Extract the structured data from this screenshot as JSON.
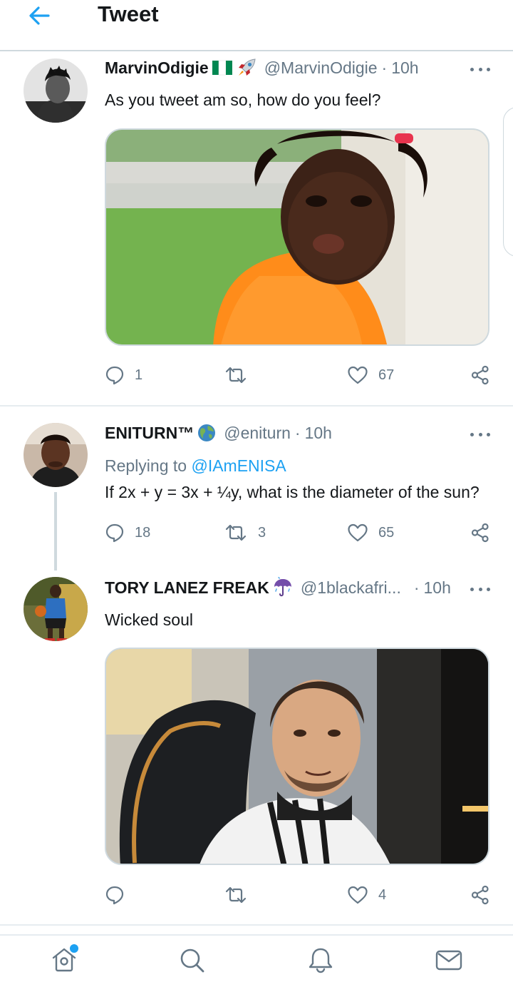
{
  "header": {
    "title": "Tweet",
    "back_icon": "arrow-left-icon",
    "accent": "#1da1f2"
  },
  "tweets": [
    {
      "name": "MarvinOdigie",
      "emojis": [
        "nigeria-flag-icon",
        "rocket-icon"
      ],
      "handle": "@MarvinOdigie",
      "time": "10h",
      "text": "As you tweet am so, how do you feel?",
      "media": "photo of a toddler in an orange top making a pouting face",
      "stats": {
        "replies": "1",
        "retweets": "",
        "likes": "67"
      }
    },
    {
      "name": "ENITURN™",
      "emojis": [
        "globe-icon"
      ],
      "handle": "@eniturn",
      "time": "10h",
      "replying_prefix": "Replying to ",
      "replying_to": "@IAmENISA",
      "text": "If 2x + y = 3x + ¼y, what is the diameter of the sun?",
      "stats": {
        "replies": "18",
        "retweets": "3",
        "likes": "65"
      }
    },
    {
      "name": "TORY LANEZ FREAK",
      "emojis": [
        "umbrella-rain-icon"
      ],
      "handle": "@1blackafri...",
      "time": "10h",
      "text": "Wicked soul",
      "media": "photo of a smiling bearded man in a white jacket",
      "stats": {
        "replies": "",
        "retweets": "",
        "likes": "4"
      }
    }
  ],
  "nav": {
    "items": [
      "home-icon",
      "search-icon",
      "notifications-icon",
      "messages-icon"
    ],
    "home_has_new": true
  }
}
